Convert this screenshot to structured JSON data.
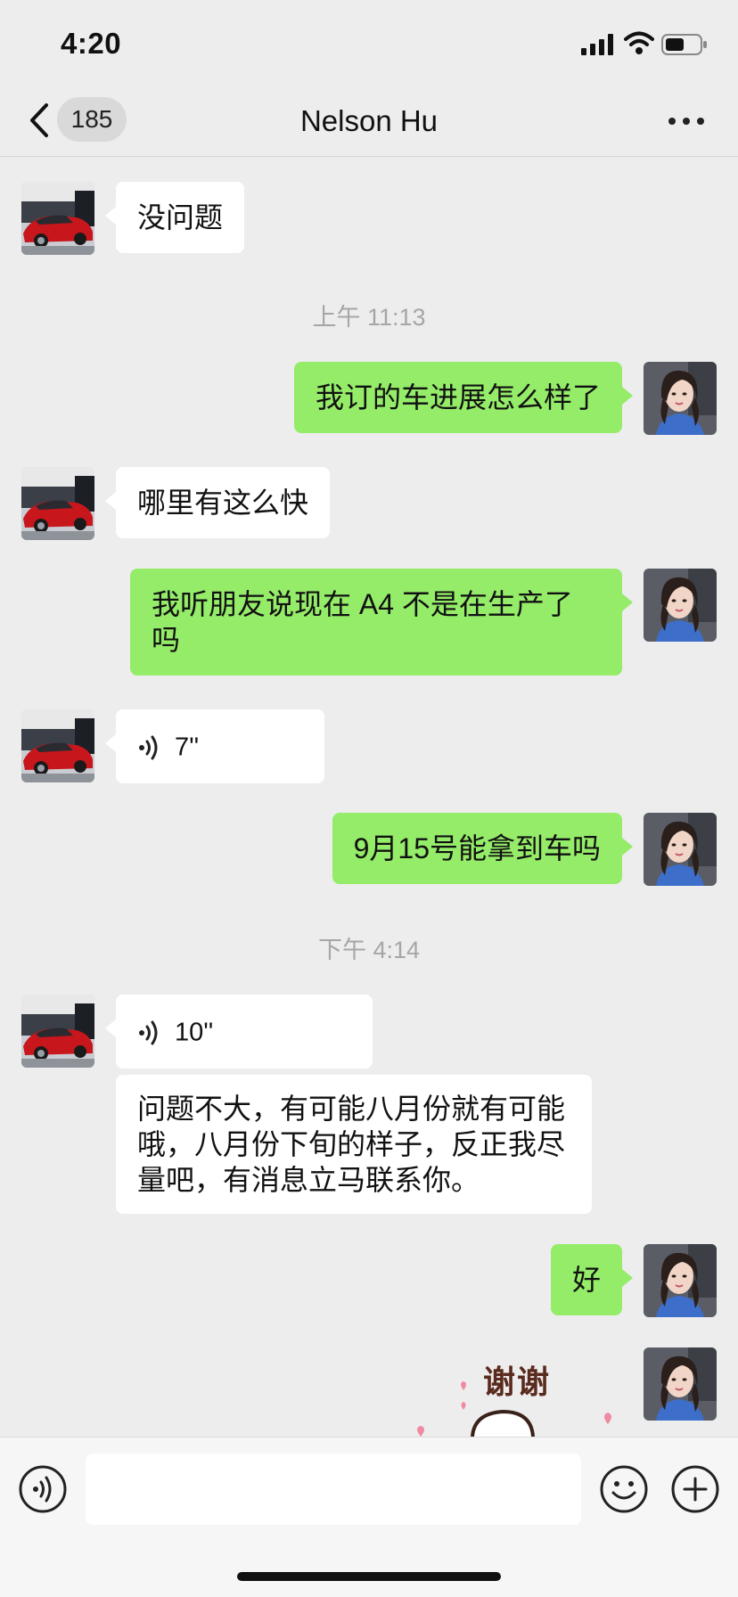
{
  "status_bar": {
    "time": "4:20"
  },
  "nav": {
    "unread_count": "185",
    "title": "Nelson Hu"
  },
  "timestamps": {
    "t1": "上午 11:13",
    "t2": "下午 4:14"
  },
  "messages": {
    "m1": "没问题",
    "m2": "我订的车进展怎么样了",
    "m3": "哪里有这么快",
    "m4": "我听朋友说现在 A4 不是在生产了吗",
    "m5_voice": "7''",
    "m6": "9月15号能拿到车吗",
    "m7_voice": "10''",
    "m8": "问题不大，有可能八月份就有可能哦，八月份下旬的样子，反正我尽量吧，有消息立马联系你。",
    "m9": "好"
  },
  "sticker": {
    "text": "谢谢"
  },
  "input": {
    "placeholder": ""
  },
  "icons": {
    "back": "chevron-left-icon",
    "more": "more-dots-icon",
    "voice": "voice-wave-icon",
    "emoji": "smiley-icon",
    "plus": "plus-circle-icon"
  },
  "colors": {
    "sent_bubble": "#95ec69",
    "received_bubble": "#ffffff",
    "background": "#ededed"
  }
}
